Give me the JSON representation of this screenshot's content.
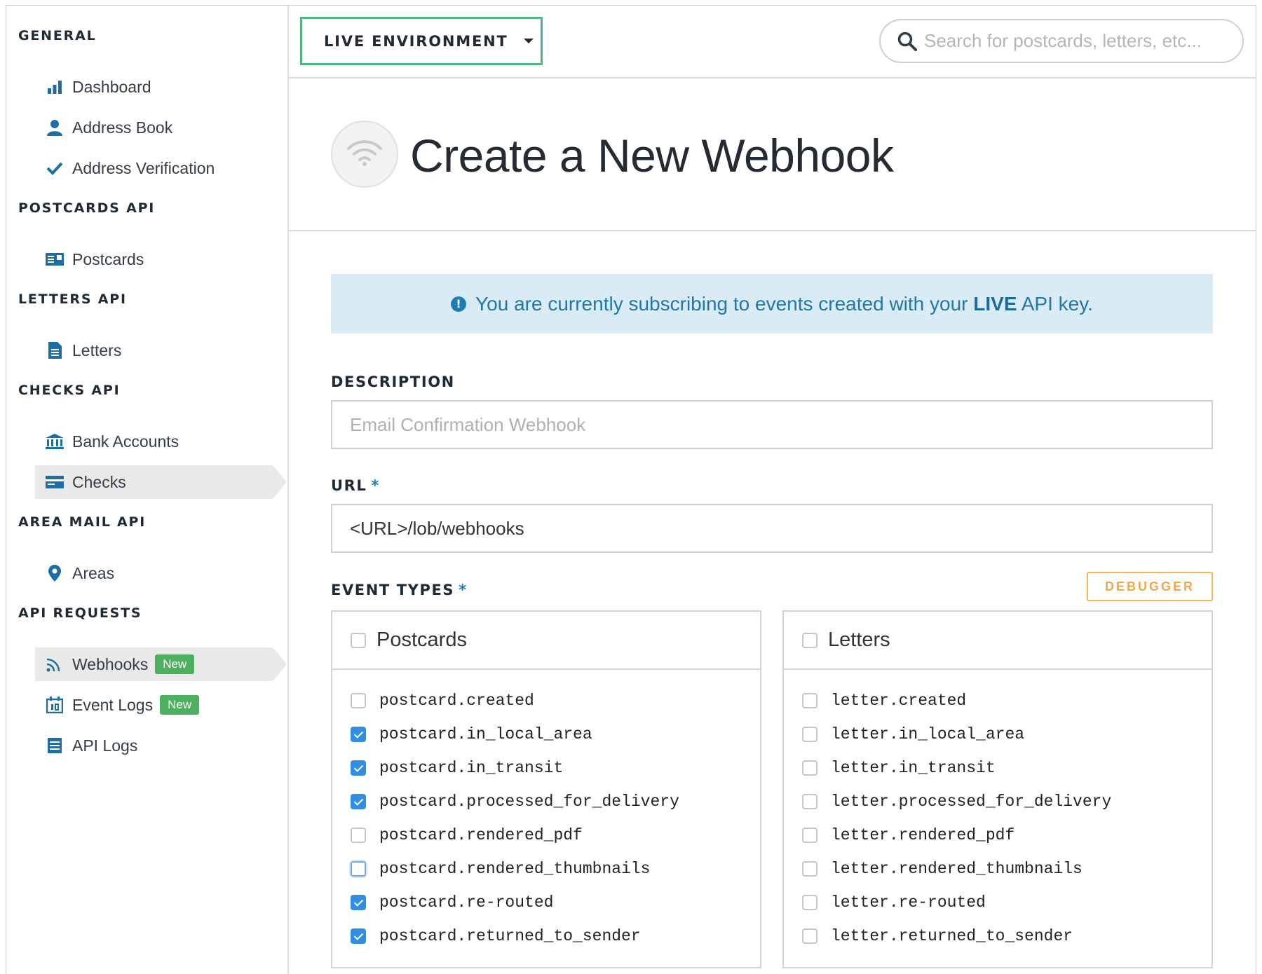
{
  "sidebar": {
    "sections": {
      "general": "GENERAL",
      "postcards": "POSTCARDS API",
      "letters": "LETTERS API",
      "checks": "CHECKS API",
      "area_mail": "AREA MAIL API",
      "api_requests": "API REQUESTS"
    },
    "items": {
      "dashboard": {
        "label": "Dashboard",
        "icon": "bar-chart-icon"
      },
      "address_book": {
        "label": "Address Book",
        "icon": "user-icon"
      },
      "address_verification": {
        "label": "Address Verification",
        "icon": "checkmark-icon"
      },
      "postcards": {
        "label": "Postcards",
        "icon": "postcard-icon"
      },
      "letters": {
        "label": "Letters",
        "icon": "document-icon"
      },
      "bank_accounts": {
        "label": "Bank Accounts",
        "icon": "bank-icon"
      },
      "checks": {
        "label": "Checks",
        "icon": "check-card-icon",
        "active": true
      },
      "areas": {
        "label": "Areas",
        "icon": "map-pin-icon"
      },
      "webhooks": {
        "label": "Webhooks",
        "icon": "rss-icon",
        "badge": "New",
        "active": true
      },
      "event_logs": {
        "label": "Event Logs",
        "icon": "calendar-icon",
        "badge": "New"
      },
      "api_logs": {
        "label": "API Logs",
        "icon": "list-icon"
      }
    },
    "accent_color": "#1e6ea3",
    "badge_color": "#4cb05e"
  },
  "topbar": {
    "environment_label": "LIVE ENVIRONMENT",
    "search_placeholder": "Search for postcards, letters, etc..."
  },
  "page": {
    "title": "Create a New Webhook",
    "icon": "wifi-icon"
  },
  "alert": {
    "text_before": "You are currently subscribing to events created with your ",
    "text_strong": "LIVE",
    "text_after": " API key."
  },
  "form": {
    "description_label": "DESCRIPTION",
    "description_placeholder": "Email Confirmation Webhook",
    "description_value": "",
    "url_label": "URL",
    "url_value": "<URL>/lob/webhooks",
    "required_mark": "*",
    "event_types_label": "EVENT TYPES",
    "debugger_label": "DEBUGGER"
  },
  "event_groups": {
    "postcards": {
      "title": "Postcards",
      "checked": false,
      "events": [
        {
          "name": "postcard.created",
          "checked": false
        },
        {
          "name": "postcard.in_local_area",
          "checked": true
        },
        {
          "name": "postcard.in_transit",
          "checked": true
        },
        {
          "name": "postcard.processed_for_delivery",
          "checked": true
        },
        {
          "name": "postcard.rendered_pdf",
          "checked": false
        },
        {
          "name": "postcard.rendered_thumbnails",
          "checked": false,
          "focused": true
        },
        {
          "name": "postcard.re-routed",
          "checked": true
        },
        {
          "name": "postcard.returned_to_sender",
          "checked": true
        }
      ]
    },
    "letters": {
      "title": "Letters",
      "checked": false,
      "events": [
        {
          "name": "letter.created",
          "checked": false
        },
        {
          "name": "letter.in_local_area",
          "checked": false
        },
        {
          "name": "letter.in_transit",
          "checked": false
        },
        {
          "name": "letter.processed_for_delivery",
          "checked": false
        },
        {
          "name": "letter.rendered_pdf",
          "checked": false
        },
        {
          "name": "letter.rendered_thumbnails",
          "checked": false
        },
        {
          "name": "letter.re-routed",
          "checked": false
        },
        {
          "name": "letter.returned_to_sender",
          "checked": false
        }
      ]
    }
  }
}
